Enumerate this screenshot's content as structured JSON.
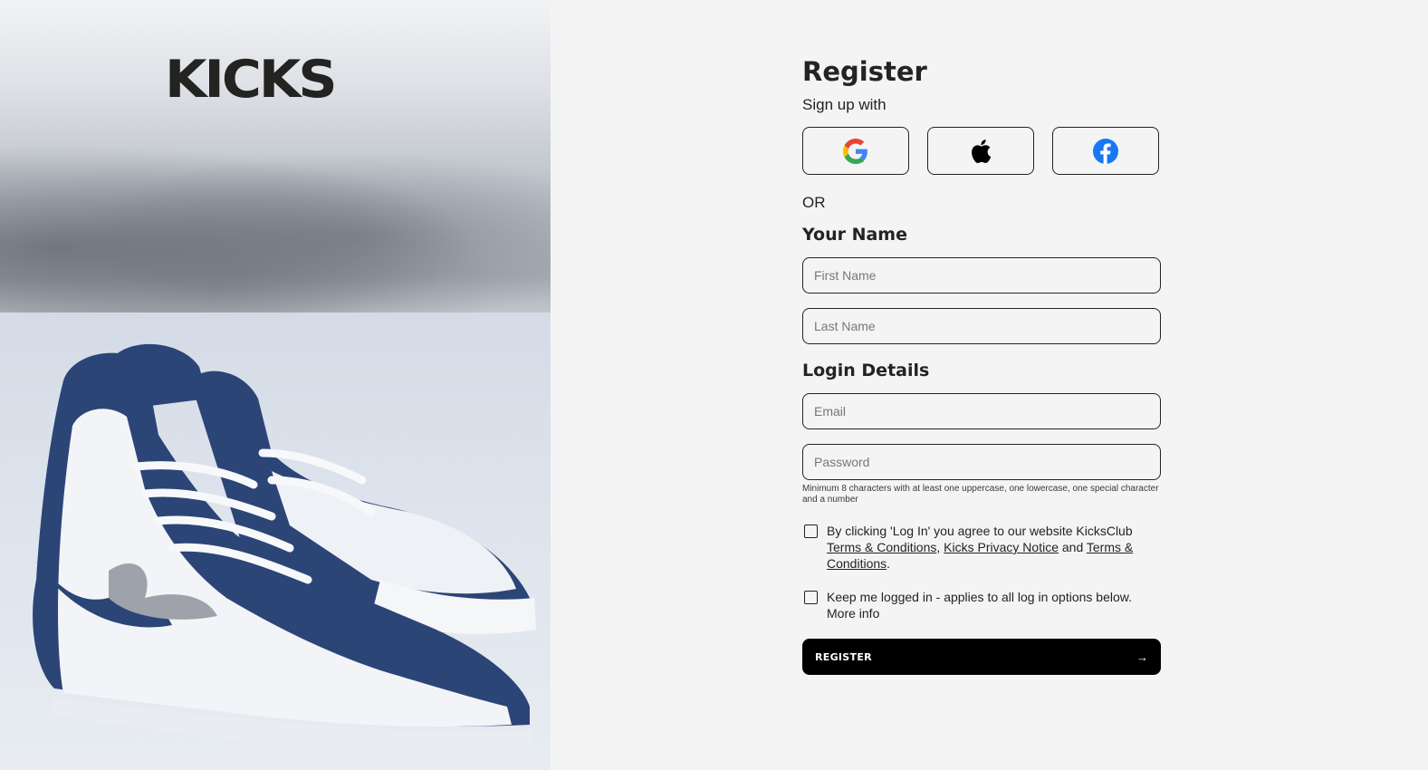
{
  "brand": {
    "logo_text": "KICKS"
  },
  "hero": {
    "image": "sneakers-in-snow"
  },
  "form": {
    "title": "Register",
    "subtitle": "Sign up with",
    "social_buttons": [
      {
        "icon": "google-icon"
      },
      {
        "icon": "apple-icon"
      },
      {
        "icon": "facebook-icon"
      }
    ],
    "divider_text": "OR",
    "name_section": "Your Name",
    "first_name_placeholder": "First Name",
    "last_name_placeholder": "Last Name",
    "login_section": "Login Details",
    "email_placeholder": "Email",
    "password_placeholder": "Password",
    "password_hint": "Minimum 8 characters with at least one uppercase, one lowercase, one special character and a number",
    "terms": {
      "prefix": "By clicking 'Log In' you agree to our website KicksClub ",
      "link1": "Terms & Conditions",
      "sep1": ", ",
      "link2": "Kicks Privacy Notice",
      "sep2": " and ",
      "link3": "Terms & Conditions",
      "suffix": "."
    },
    "keep_logged_in": {
      "text": "Keep me logged in - applies to all log in options below.",
      "more": "More info"
    },
    "register_label": "REGISTER",
    "register_arrow": "→"
  },
  "colors": {
    "text": "#232321",
    "background": "#f4f4f4",
    "button": "#000000",
    "google_blue": "#4285F4",
    "facebook_blue": "#1877F2"
  }
}
